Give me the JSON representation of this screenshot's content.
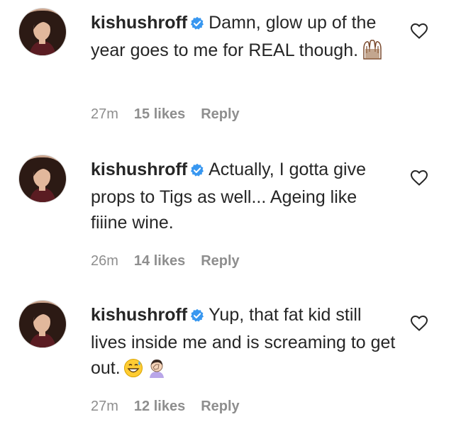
{
  "comments": [
    {
      "username": "kishushroff",
      "text": "Damn, glow up of the year goes to me for REAL though.",
      "emojis": [
        "raising-hands"
      ],
      "time": "27m",
      "likes": "15 likes",
      "reply_label": "Reply"
    },
    {
      "username": "kishushroff",
      "text": "Actually, I gotta give props to Tigs as well... Ageing like fiiine wine.",
      "emojis": [],
      "time": "26m",
      "likes": "14 likes",
      "reply_label": "Reply"
    },
    {
      "username": "kishushroff",
      "text": "Yup, that fat kid still lives inside me and is screaming to get out.",
      "emojis": [
        "grinning-sweat",
        "facepalm"
      ],
      "time": "27m",
      "likes": "12 likes",
      "reply_label": "Reply"
    }
  ],
  "colors": {
    "text": "#262626",
    "meta": "#8e8e8e",
    "verified": "#3897f0"
  },
  "icons": {
    "like": "heart-outline-icon",
    "verified": "verified-badge-icon"
  }
}
